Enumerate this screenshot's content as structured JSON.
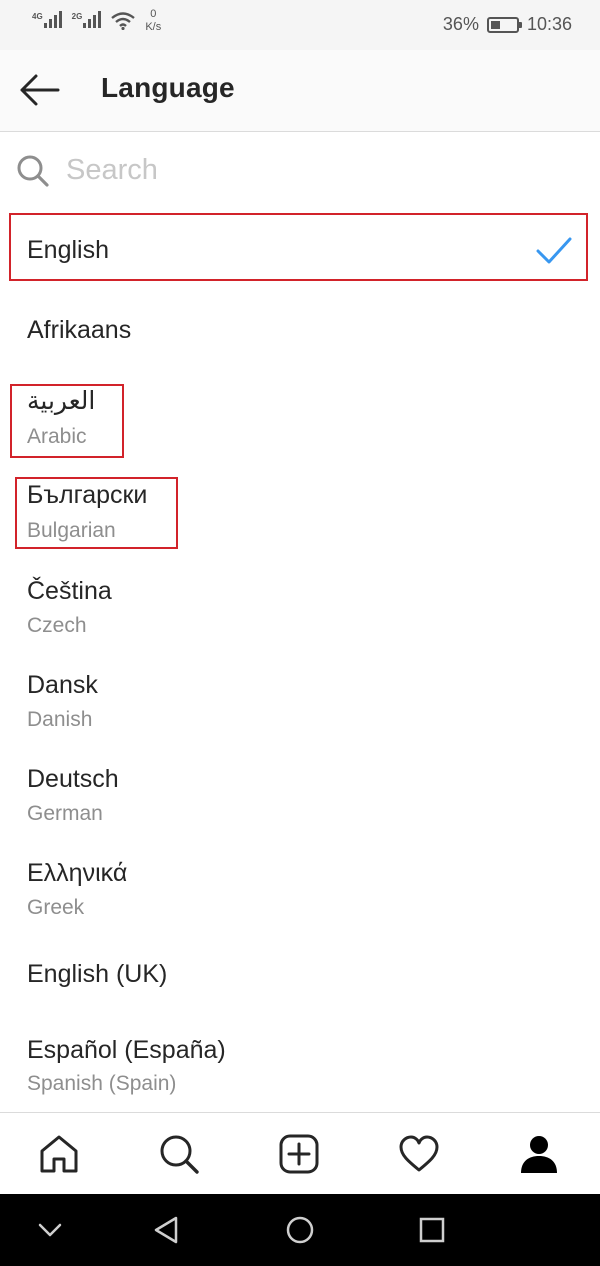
{
  "status_bar": {
    "signal1_label": "4G",
    "signal2_label": "2G",
    "speed_value": "0",
    "speed_unit": "K/s",
    "battery_text": "36%",
    "battery_level": 0.36,
    "time": "10:36"
  },
  "header": {
    "title": "Language",
    "back_icon": "arrow-left-icon"
  },
  "search": {
    "placeholder": "Search",
    "value": "",
    "icon": "search-icon"
  },
  "languages": [
    {
      "name": "English",
      "subtitle": "",
      "selected": true
    },
    {
      "name": "Afrikaans",
      "subtitle": "",
      "selected": false
    },
    {
      "name": "العربية",
      "subtitle": "Arabic",
      "selected": false
    },
    {
      "name": "Български",
      "subtitle": "Bulgarian",
      "selected": false
    },
    {
      "name": "Čeština",
      "subtitle": "Czech",
      "selected": false
    },
    {
      "name": "Dansk",
      "subtitle": "Danish",
      "selected": false
    },
    {
      "name": "Deutsch",
      "subtitle": "German",
      "selected": false
    },
    {
      "name": "Ελληνικά",
      "subtitle": "Greek",
      "selected": false
    },
    {
      "name": "English (UK)",
      "subtitle": "",
      "selected": false
    },
    {
      "name": "Español (España)",
      "subtitle": "Spanish (Spain)",
      "selected": false
    }
  ],
  "bottom_nav": [
    "home-icon",
    "search-icon",
    "add-post-icon",
    "heart-icon",
    "profile-icon"
  ],
  "system_nav": [
    "collapse-chevron-icon",
    "back-triangle-icon",
    "home-circle-icon",
    "recents-square-icon"
  ],
  "colors": {
    "accent_check": "#3897f0",
    "highlight_box": "#d2232a",
    "primary_text": "#262626",
    "secondary_text": "#8e8e8e"
  }
}
